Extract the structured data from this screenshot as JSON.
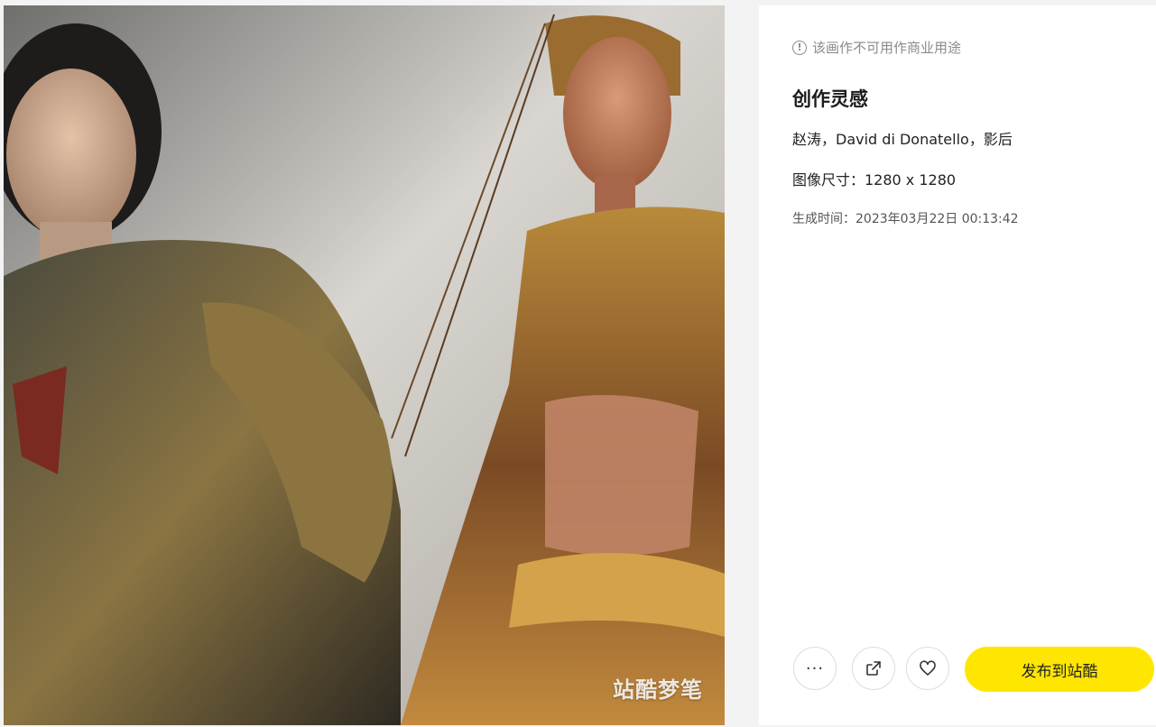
{
  "artwork": {
    "watermark": "站酷梦笔"
  },
  "panel": {
    "notice": "该画作不可用作商业用途",
    "section_title": "创作灵感",
    "prompt": "赵涛，David di Donatello，影后",
    "image_size": "图像尺寸：1280 x 1280",
    "generated_time": "生成时间：2023年03月22日 00:13:42"
  },
  "actions": {
    "more_label": "···",
    "publish_label": "发布到站酷"
  },
  "icons": {
    "notice": "info-circle-icon",
    "more": "more-dots-icon",
    "share": "share-external-icon",
    "like": "heart-outline-icon"
  },
  "colors": {
    "publish_button": "#ffe600",
    "page_background": "#f3f3f3"
  }
}
